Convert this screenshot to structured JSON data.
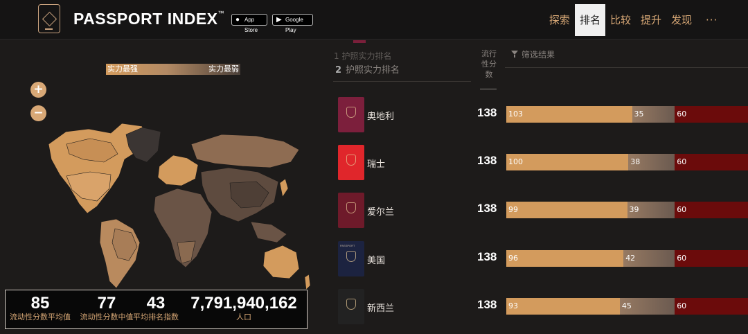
{
  "header": {
    "brand": "PASSPORT INDEX",
    "brand_tm": "™",
    "app_store": "App Store",
    "google_play": "Google Play",
    "nav": [
      "探索",
      "排名",
      "比较",
      "提升",
      "发现"
    ],
    "active_nav": "排名",
    "more": "···"
  },
  "map": {
    "legend_strong": "实力最强",
    "legend_weak": "实力最弱",
    "zoom_in": "+",
    "zoom_out": "−"
  },
  "stats": [
    {
      "value": "85",
      "label": "流动性分数平均值"
    },
    {
      "value": "77",
      "label": "流动性分数中值"
    },
    {
      "value": "43",
      "label": "平均排名指数"
    },
    {
      "value": "7,791,940,162",
      "label": "人口"
    }
  ],
  "ranking": {
    "prev_heading": "1  护照实力排名",
    "heading_num": "2",
    "heading": "护照实力排名",
    "score_column": "流行性分数",
    "filter_label": "筛选结果",
    "rows": [
      {
        "country": "奥地利",
        "score": "138",
        "visa_free": 103,
        "on_arrival": 35,
        "required": 60,
        "passport_color": "#7c1f3c",
        "passport_text": ""
      },
      {
        "country": "瑞士",
        "score": "138",
        "visa_free": 100,
        "on_arrival": 38,
        "required": 60,
        "passport_color": "#e0262b",
        "passport_text": ""
      },
      {
        "country": "爱尔兰",
        "score": "138",
        "visa_free": 99,
        "on_arrival": 39,
        "required": 60,
        "passport_color": "#6e1a2a",
        "passport_text": ""
      },
      {
        "country": "美国",
        "score": "138",
        "visa_free": 96,
        "on_arrival": 42,
        "required": 60,
        "passport_color": "#1c2340",
        "passport_text": "PASSPORT"
      },
      {
        "country": "新西兰",
        "score": "138",
        "visa_free": 93,
        "on_arrival": 45,
        "required": 60,
        "passport_color": "#222222",
        "passport_text": ""
      }
    ]
  },
  "colors": {
    "accent": "#d8a876",
    "visa_free": "#d39b5d",
    "on_arrival": "#8a7060",
    "required": "#6b0b0b"
  }
}
